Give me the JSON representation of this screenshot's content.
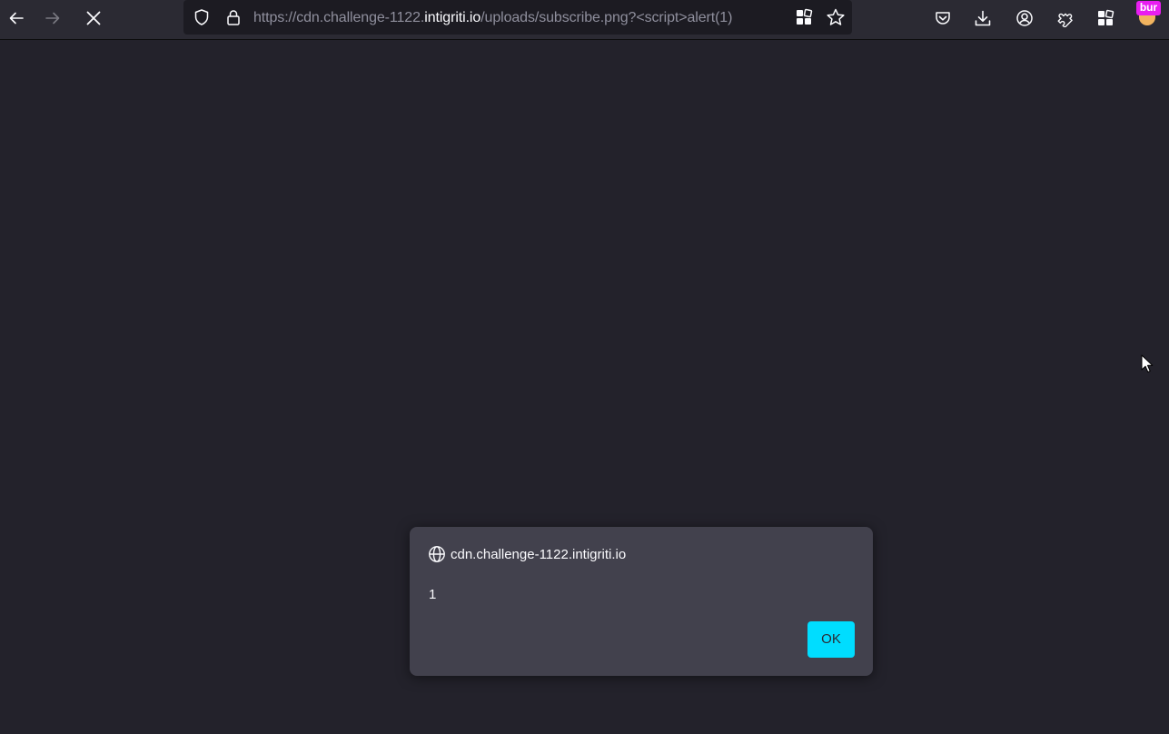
{
  "browser": {
    "toolbar": {
      "back": "back-arrow-icon",
      "forward": "forward-arrow-icon",
      "stop": "close-icon"
    },
    "url": {
      "prefix": "https://cdn.challenge-1122.",
      "host": "intigriti.io",
      "suffix": "/uploads/subscribe.png?<script>alert(1)"
    },
    "extension_badge": "bur"
  },
  "dialog": {
    "origin": "cdn.challenge-1122.intigriti.io",
    "message": "1",
    "ok_label": "OK"
  },
  "colors": {
    "page_background": "#23222b",
    "toolbar_background": "#2b2a33",
    "dialog_background": "#42414d",
    "accent_button": "#00ddff"
  }
}
